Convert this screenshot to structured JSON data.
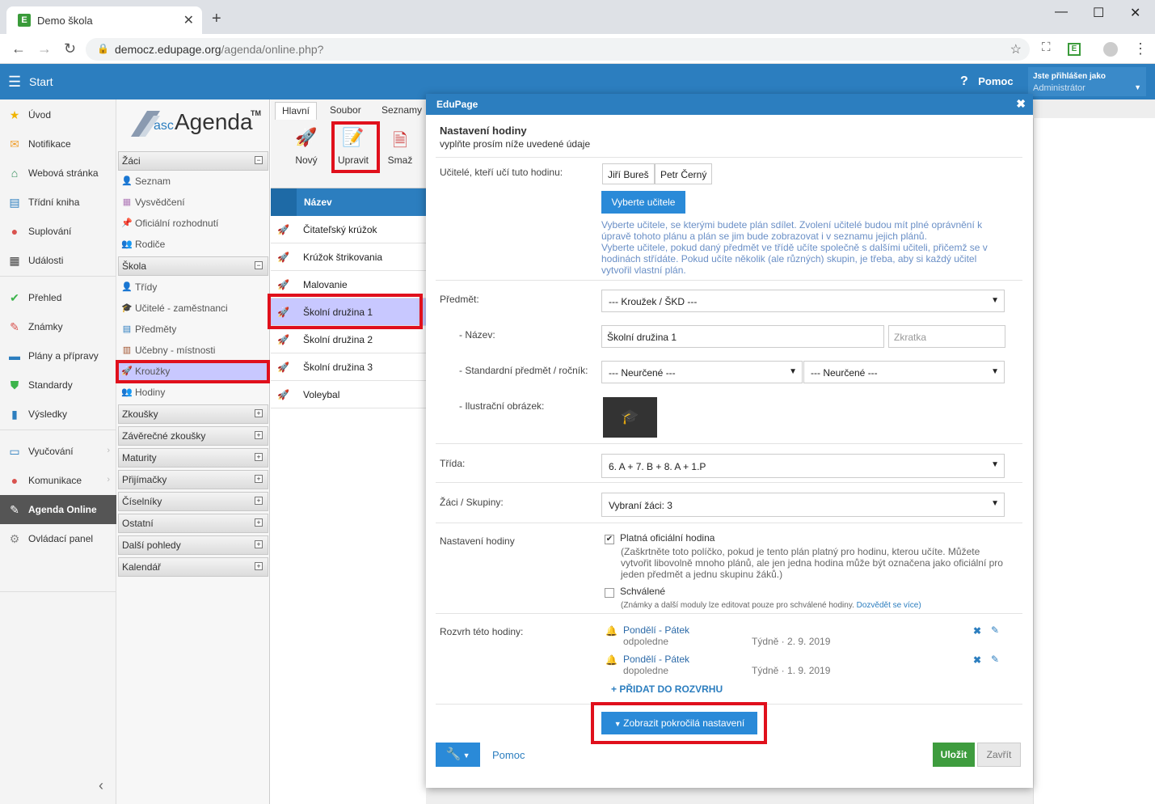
{
  "browser": {
    "tab_title": "Demo škola",
    "url_host": "democz.edupage.org",
    "url_path": "/agenda/online.php?"
  },
  "header": {
    "start": "Start",
    "help": "Pomoc",
    "logged_in_as": "Jste přihlášen jako",
    "user": "Administrátor"
  },
  "leftnav": [
    {
      "label": "Úvod",
      "icon": "star-icon",
      "color": "#f0b400"
    },
    {
      "label": "Notifikace",
      "icon": "envelope-icon",
      "color": "#f0a030"
    },
    {
      "label": "Webová stránka",
      "icon": "house-icon",
      "color": "#2e8b57"
    },
    {
      "label": "Třídní kniha",
      "icon": "book-icon",
      "color": "#2c7ebf"
    },
    {
      "label": "Suplování",
      "icon": "person-icon",
      "color": "#d9534f"
    },
    {
      "label": "Události",
      "icon": "calendar-icon",
      "color": "#444"
    },
    {
      "label": "Přehled",
      "icon": "check-circle-icon",
      "color": "#3cb44b"
    },
    {
      "label": "Známky",
      "icon": "grade-icon",
      "color": "#d9534f"
    },
    {
      "label": "Plány a přípravy",
      "icon": "briefcase-icon",
      "color": "#2c7ebf"
    },
    {
      "label": "Standardy",
      "icon": "shield-icon",
      "color": "#3cb44b"
    },
    {
      "label": "Výsledky",
      "icon": "bar-chart-icon",
      "color": "#2c7ebf"
    },
    {
      "label": "Vyučování",
      "icon": "open-book-icon",
      "color": "#2c7ebf"
    },
    {
      "label": "Komunikace",
      "icon": "chat-icon",
      "color": "#d9534f"
    },
    {
      "label": "Agenda Online",
      "icon": "pen-icon",
      "color": "#ffffff"
    },
    {
      "label": "Ovládací panel",
      "icon": "gear-icon",
      "color": "#888"
    }
  ],
  "agenda": {
    "logo_prefix": "asc",
    "logo_main": "Agenda",
    "logo_tm": "TM",
    "sections": {
      "zaci": "Žáci",
      "zaci_items": [
        "Seznam",
        "Vysvědčení",
        "Oficiální rozhodnutí",
        "Rodiče"
      ],
      "skola": "Škola",
      "skola_items": [
        "Třídy",
        "Učitelé - zaměstnanci",
        "Předměty",
        "Učebny - místnosti",
        "Kroužky",
        "Hodiny"
      ],
      "collapsed": [
        "Zkoušky",
        "Závěrečné zkoušky",
        "Maturity",
        "Přijímačky",
        "Číselníky",
        "Ostatní",
        "Další pohledy",
        "Kalendář"
      ]
    }
  },
  "ribbon": {
    "tabs": [
      "Hlavní",
      "Soubor",
      "Seznamy"
    ],
    "buttons": [
      "Nový",
      "Upravit",
      "Smaž"
    ]
  },
  "list": {
    "header": "Název",
    "rows": [
      "Čitateľský krúžok",
      "Krúžok štrikovania",
      "Malovanie",
      "Školní družina 1",
      "Školní družina 2",
      "Školní družina 3",
      "Voleybal"
    ]
  },
  "modal": {
    "window_title": "EduPage",
    "title": "Nastavení hodiny",
    "subtitle": "vyplňte prosím níže uvedené údaje",
    "teachers_label": "Učitelé, kteří učí tuto hodinu:",
    "teachers": [
      "Jiří Bureš",
      "Petr Černý"
    ],
    "select_teachers_btn": "Vyberte učitele",
    "teachers_hint": [
      "Vyberte učitele, se kterými budete plán sdílet. Zvolení učitelé budou mít plné oprávnění k",
      "úpravě tohoto plánu a plán se jim bude zobrazovat i v seznamu jejich plánů.",
      "Vyberte učitele, pokud daný předmět ve třídě učíte společně s dalšími učiteli, přičemž se v",
      "hodinách střídáte. Pokud učíte několik (ale různých) skupin, je třeba, aby si každý učitel",
      "vytvořil vlastní plán."
    ],
    "subject_label": "Předmět:",
    "subject_value": "--- Kroužek / ŠKD ---",
    "name_label": "- Název:",
    "name_value": "Školní družina 1",
    "abbr_placeholder": "Zkratka",
    "std_label": "- Standardní předmět / ročník:",
    "std_value1": "--- Neurčené ---",
    "std_value2": "--- Neurčené ---",
    "image_label": "- Ilustrační obrázek:",
    "class_label": "Třída:",
    "class_value": "6. A + 7. B + 8. A + 1.P",
    "students_label": "Žáci / Skupiny:",
    "students_value": "Vybraní žáci: 3",
    "lesson_settings_label": "Nastavení hodiny",
    "official_label": "Platná oficiální hodina",
    "official_checked": true,
    "official_hint": [
      "(Zaškrtněte toto políčko, pokud je tento plán platný pro hodinu, kterou učíte. Můžete",
      "vytvořit libovolně mnoho plánů, ale jen jedna hodina může být označena jako oficiální pro",
      "jeden předmět a jednu skupinu žáků.)"
    ],
    "approved_label": "Schválené",
    "approved_hint": "(Známky a další moduly lze editovat pouze pro schválené hodiny. ",
    "approved_link": "Dozvědět se více)",
    "schedule_label": "Rozvrh této hodiny:",
    "schedule": [
      {
        "days": "Pondělí - Pátek",
        "time": "odpoledne",
        "freq": "Týdně · 2. 9. 2019"
      },
      {
        "days": "Pondělí - Pátek",
        "time": "dopoledne",
        "freq": "Týdně · 1. 9. 2019"
      }
    ],
    "add_schedule": "+ PŘIDAT DO ROZVRHU",
    "advanced_btn": "Zobrazit pokročilá nastavení",
    "help": "Pomoc",
    "save": "Uložit",
    "close": "Zavřít"
  }
}
